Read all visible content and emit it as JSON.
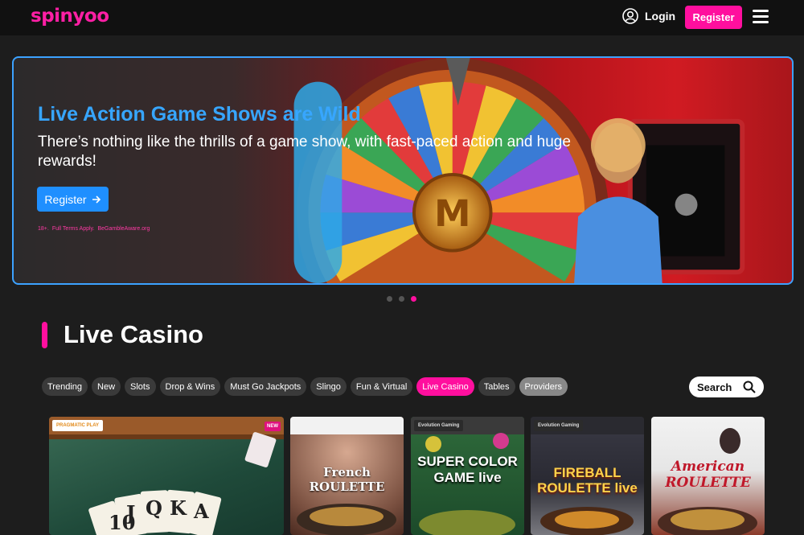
{
  "header": {
    "logo": "spinyoo",
    "login_label": "Login",
    "register_label": "Register"
  },
  "hero": {
    "title": "Live Action Game Shows are Wild",
    "subtitle": "There’s nothing like the thrills of a game show, with fast-paced action and huge rewards!",
    "cta_label": "Register",
    "cta_icon": "arrow-right-icon",
    "terms": [
      "18+.",
      "Full Terms Apply.",
      "BeGambleAware.org"
    ],
    "active_slide": 3,
    "slide_count": 3
  },
  "section": {
    "title": "Live Casino"
  },
  "filters": [
    {
      "label": "Trending",
      "active": false
    },
    {
      "label": "New",
      "active": false
    },
    {
      "label": "Slots",
      "active": false
    },
    {
      "label": "Drop & Wins",
      "active": false
    },
    {
      "label": "Must Go Jackpots",
      "active": false
    },
    {
      "label": "Slingo",
      "active": false
    },
    {
      "label": "Fun & Virtual",
      "active": false
    },
    {
      "label": "Live Casino",
      "active": true
    },
    {
      "label": "Tables",
      "active": false
    },
    {
      "label": "Providers",
      "active": false
    }
  ],
  "search": {
    "label": "Search",
    "icon": "search-icon"
  },
  "games": [
    {
      "provider": "PRAGMATIC PLAY",
      "name": "",
      "badge": "NEW"
    },
    {
      "provider": "",
      "name": "French ROULETTE",
      "badge": ""
    },
    {
      "provider": "Evolution Gaming",
      "name": "SUPER COLOR GAME live",
      "badge": ""
    },
    {
      "provider": "Evolution Gaming",
      "name": "FIREBALL ROULETTE live",
      "badge": ""
    },
    {
      "provider": "",
      "name": "American ROULETTE",
      "badge": ""
    }
  ],
  "colors": {
    "accent": "#ff0f9e",
    "hero_border": "#3ca2ff",
    "hero_title": "#37a6ff",
    "background": "#1d1d1d"
  }
}
